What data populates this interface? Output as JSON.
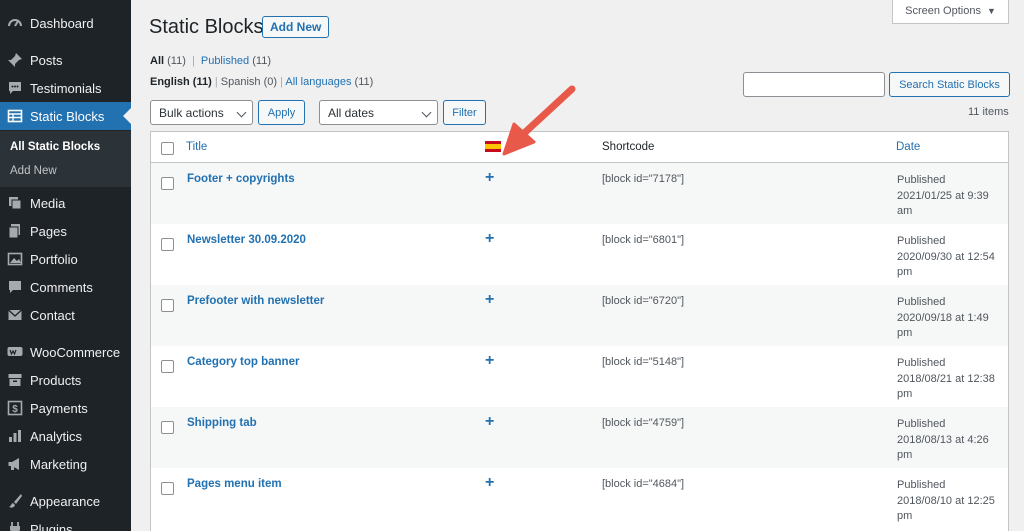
{
  "sidebar": {
    "items": [
      {
        "label": "Dashboard",
        "icon": "dashboard-icon"
      },
      {
        "label": "Posts",
        "icon": "pin-icon"
      },
      {
        "label": "Testimonials",
        "icon": "comment-bubble-icon"
      },
      {
        "label": "Static Blocks",
        "icon": "table-icon"
      },
      {
        "label": "Media",
        "icon": "media-icon"
      },
      {
        "label": "Pages",
        "icon": "pages-icon"
      },
      {
        "label": "Portfolio",
        "icon": "portfolio-icon"
      },
      {
        "label": "Comments",
        "icon": "comments-icon"
      },
      {
        "label": "Contact",
        "icon": "mail-icon"
      },
      {
        "label": "WooCommerce",
        "icon": "woo-icon"
      },
      {
        "label": "Products",
        "icon": "archive-icon"
      },
      {
        "label": "Payments",
        "icon": "dollar-icon"
      },
      {
        "label": "Analytics",
        "icon": "bar-chart-icon"
      },
      {
        "label": "Marketing",
        "icon": "megaphone-icon"
      },
      {
        "label": "Appearance",
        "icon": "brush-icon"
      },
      {
        "label": "Plugins",
        "icon": "plug-icon"
      }
    ],
    "submenu": [
      "All Static Blocks",
      "Add New"
    ]
  },
  "header": {
    "title": "Static Blocks",
    "add_new": "Add New",
    "screen_options": "Screen Options"
  },
  "filters": {
    "status": {
      "all": "All",
      "all_count": "(11)",
      "sep": "|",
      "published": "Published",
      "published_count": "(11)"
    },
    "languages": {
      "english": "English",
      "english_count": "(11)",
      "spanish": "Spanish",
      "spanish_count": "(0)",
      "all": "All languages",
      "all_count": "(11)"
    }
  },
  "search": {
    "placeholder": "",
    "button": "Search Static Blocks"
  },
  "toolbar": {
    "bulk_actions": "Bulk actions",
    "apply": "Apply",
    "dates": "All dates",
    "filter": "Filter",
    "items_count": "11 items"
  },
  "table": {
    "columns": {
      "title": "Title",
      "shortcode": "Shortcode",
      "date": "Date"
    },
    "rows": [
      {
        "title": "Footer + copyrights",
        "plus": "+",
        "shortcode": "[block id=\"7178\"]",
        "date": "Published\n2021/01/25 at 9:39 am"
      },
      {
        "title": "Newsletter 30.09.2020",
        "plus": "+",
        "shortcode": "[block id=\"6801\"]",
        "date": "Published\n2020/09/30 at 12:54 pm"
      },
      {
        "title": "Prefooter with newsletter",
        "plus": "+",
        "shortcode": "[block id=\"6720\"]",
        "date": "Published\n2020/09/18 at 1:49 pm"
      },
      {
        "title": "Category top banner",
        "plus": "+",
        "shortcode": "[block id=\"5148\"]",
        "date": "Published\n2018/08/21 at 12:38 pm"
      },
      {
        "title": "Shipping tab",
        "plus": "+",
        "shortcode": "[block id=\"4759\"]",
        "date": "Published\n2018/08/13 at 4:26 pm"
      },
      {
        "title": "Pages menu item",
        "plus": "+",
        "shortcode": "[block id=\"4684\"]",
        "date": "Published\n2018/08/10 at 12:25 pm"
      }
    ]
  },
  "colors": {
    "sidebar_bg": "#1d2327",
    "accent": "#2271b1",
    "arrow": "#e8594a"
  }
}
